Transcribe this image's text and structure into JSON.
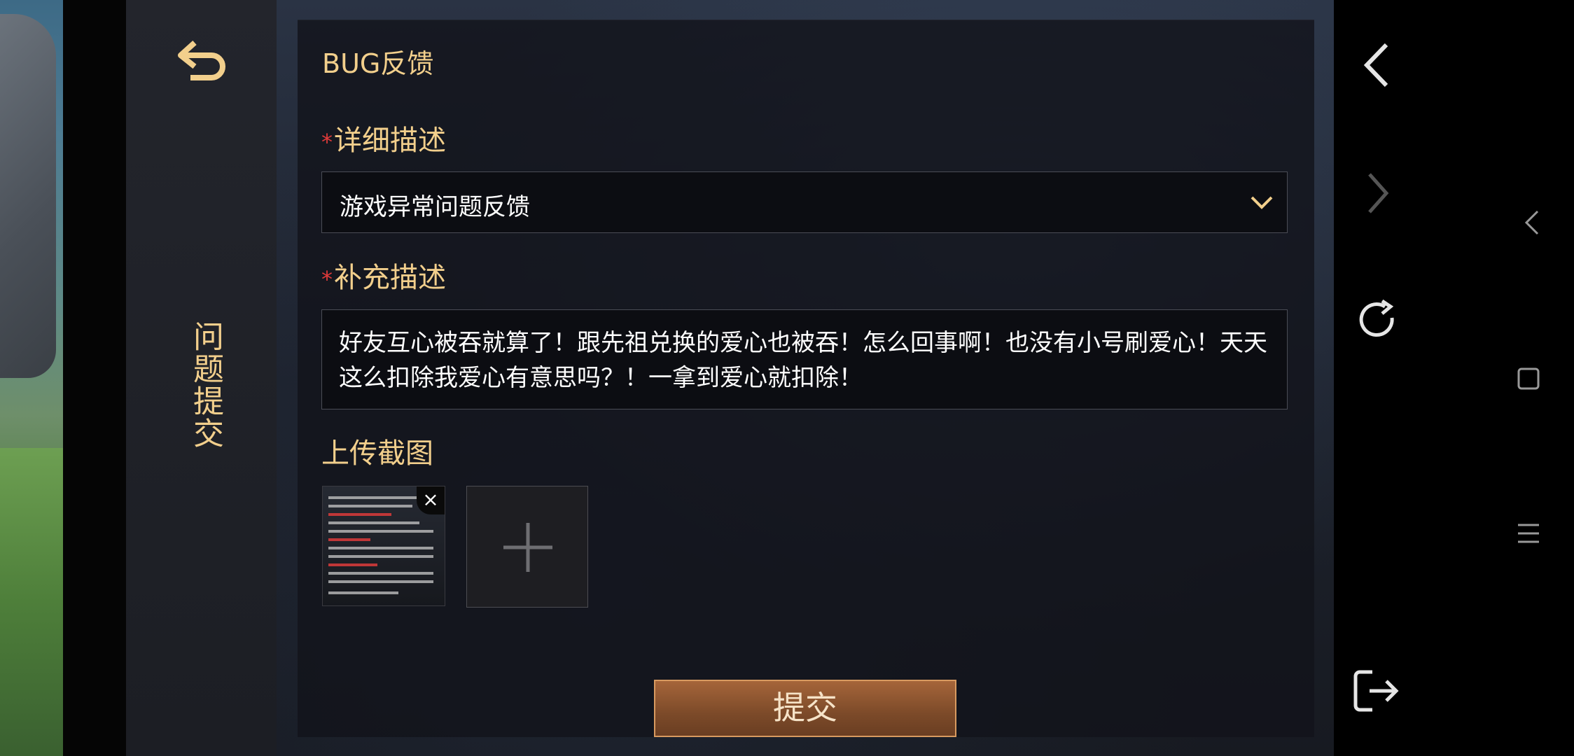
{
  "panel": {
    "title": "BUG反馈",
    "side_title": "问题提交",
    "required_mark": "*",
    "detail_label": "详细描述",
    "detail_selected": "游戏异常问题反馈",
    "supplement_label": "补充描述",
    "supplement_text": "好友互心被吞就算了！跟先祖兑换的爱心也被吞！怎么回事啊！也没有小号刷爱心！天天这么扣除我爱心有意思吗？！一拿到爱心就扣除！",
    "upload_label": "上传截图",
    "thumbnail_close": "×",
    "submit_label": "提交"
  },
  "icons": {
    "back": "back-arrow-icon",
    "chevron": "chevron-down-icon",
    "plus": "plus-icon",
    "nav_back": "chevron-left-icon",
    "nav_forward": "chevron-right-icon",
    "nav_reload": "reload-icon",
    "nav_exit": "exit-icon"
  },
  "colors": {
    "accent": "#f2cf8c",
    "required": "#e03a3a",
    "button": "#8a522d"
  }
}
